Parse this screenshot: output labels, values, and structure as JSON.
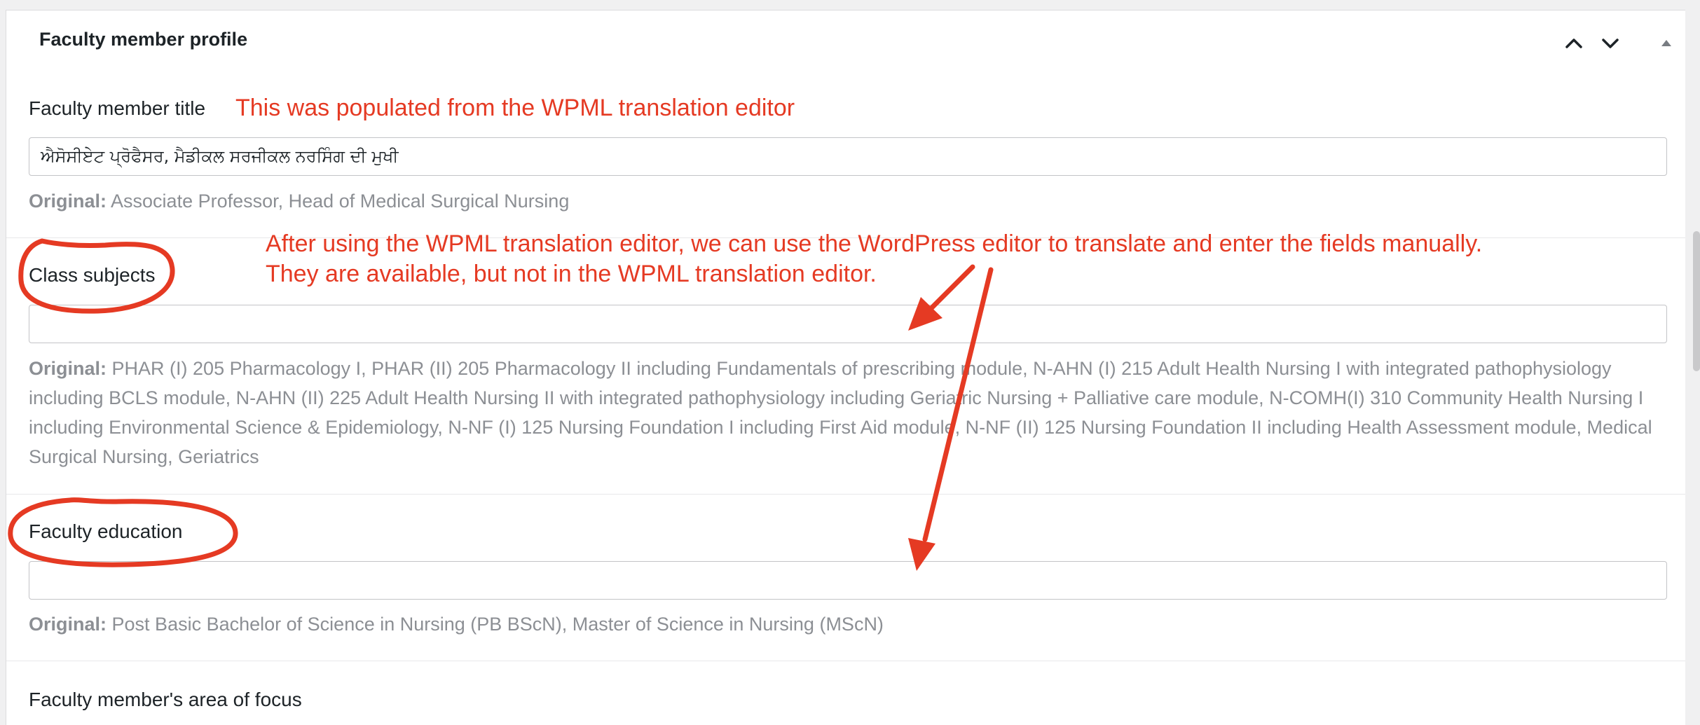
{
  "panel": {
    "title": "Faculty member profile"
  },
  "fields": [
    {
      "label": "Faculty member title",
      "value": "ਐਸੋਸੀਏਟ ਪ੍ਰੋਫੈਸਰ, ਮੈਡੀਕਲ ਸਰਜੀਕਲ ਨਰਸਿੰਗ ਦੀ ਮੁਖੀ",
      "original_prefix": "Original:",
      "original": "Associate Professor, Head of Medical Surgical Nursing"
    },
    {
      "label": "Class subjects",
      "value": "",
      "original_prefix": "Original:",
      "original": "PHAR (I) 205 Pharmacology I, PHAR (II) 205 Pharmacology II including Fundamentals of prescribing module, N-AHN (I) 215 Adult Health Nursing I with integrated pathophysiology including BCLS module, N-AHN (II) 225 Adult Health Nursing II with integrated pathophysiology including Geriatric Nursing + Palliative care module, N-COMH(I) 310 Community Health Nursing I including Environmental Science & Epidemiology, N-NF (I) 125 Nursing Foundation I including First Aid module, N-NF (II) 125 Nursing Foundation II including Health Assessment module, Medical Surgical Nursing, Geriatrics"
    },
    {
      "label": "Faculty education",
      "value": "",
      "original_prefix": "Original:",
      "original": "Post Basic Bachelor of Science in Nursing (PB BScN), Master of Science in Nursing (MScN)"
    },
    {
      "label": "Faculty member's area of focus"
    }
  ],
  "annotations": {
    "note1": "This was populated from the WPML translation editor",
    "note2_line1": "After using the WPML translation editor, we can use the WordPress editor to translate and enter the fields manually.",
    "note2_line2": "They are available, but not in the WPML translation editor.",
    "color": "#e53a23"
  },
  "icons": [
    "chevron-up-icon",
    "chevron-down-icon",
    "triangle-up-icon"
  ]
}
